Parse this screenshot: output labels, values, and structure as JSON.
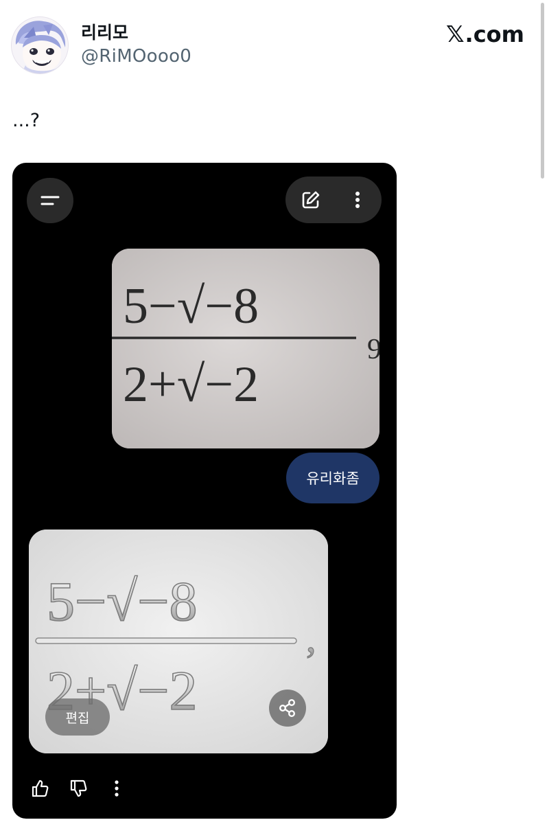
{
  "tweet": {
    "display_name": "리리모",
    "handle": "@RiMOooo0",
    "brand": ".com",
    "brand_logo": "𝕏",
    "text": "...?"
  },
  "card": {
    "prompt": "유리화좀",
    "edit_label": "편집",
    "icons": [
      "menu-icon",
      "edit-icon",
      "more-vertical-icon",
      "share-icon",
      "thumbs-up-icon",
      "thumbs-down-icon",
      "more-vertical-icon"
    ]
  },
  "photo_original": {
    "numerator": "5−√−8",
    "denominator": "2+√−2",
    "trailing": "9"
  },
  "photo_glass": {
    "numerator": "5−√−8",
    "denominator": "2+√−2",
    "trailing": ","
  },
  "colors": {
    "card_background": "#000000",
    "prompt_bubble": "#1f3666",
    "handle_text": "#536471",
    "button_background": "#2a2a2a"
  }
}
